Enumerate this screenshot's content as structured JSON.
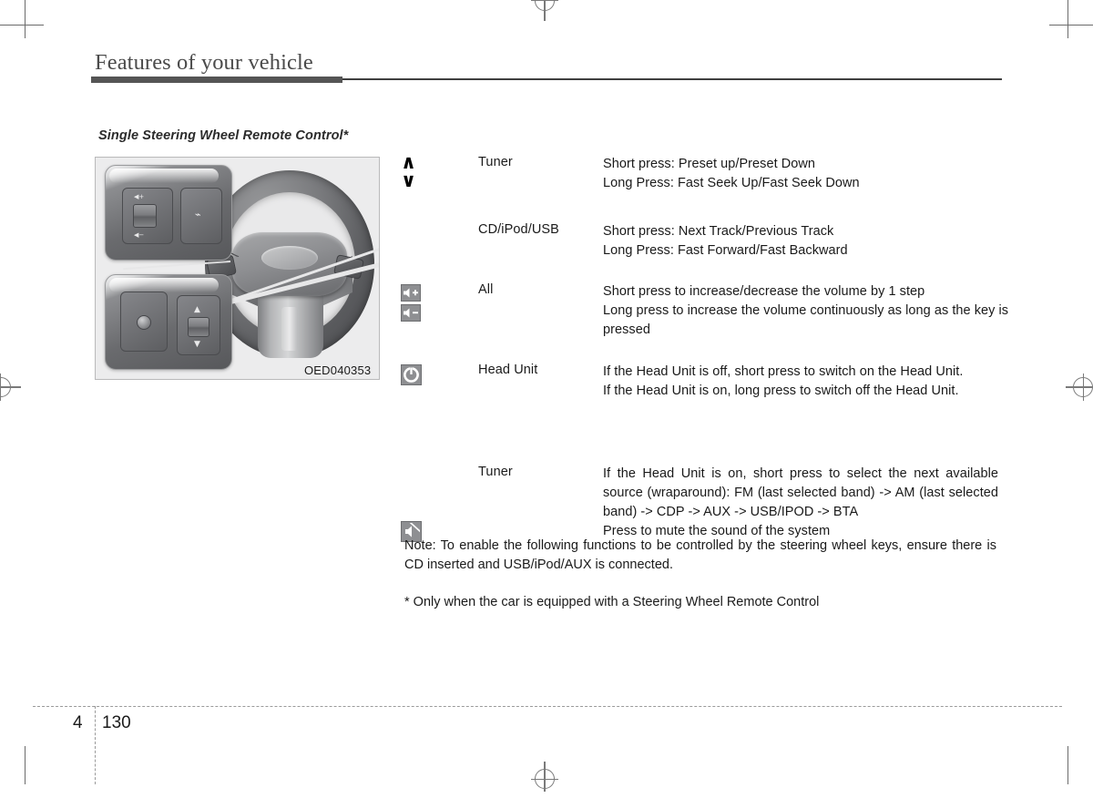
{
  "page": {
    "chapter_title": "Features of your vehicle",
    "section_title": "Single Steering Wheel Remote Control*",
    "chapter_number": "4",
    "page_number": "130"
  },
  "figure": {
    "caption": "OED040353",
    "alt_name": "steering-wheel-remote-control-illustration"
  },
  "table": {
    "rows": [
      {
        "icon": "seek-up-down-chevrons-icon",
        "mode": "Tuner",
        "lines": [
          "Short press: Preset up/Preset Down",
          "Long Press: Fast Seek Up/Fast Seek Down"
        ]
      },
      {
        "icon": "none",
        "mode": "CD/iPod/USB",
        "lines": [
          "Short press: Next Track/Previous Track",
          "Long Press: Fast Forward/Fast Backward"
        ]
      },
      {
        "icon": "volume-up-down-icon",
        "mode": "All",
        "lines": [
          "Short press to increase/decrease the volume by 1 step",
          "Long press to increase the volume continuously as long as the key is pressed"
        ]
      },
      {
        "icon": "power-mode-icon",
        "mode": "Head Unit",
        "lines": [
          "If the Head Unit is off, short press to switch on the Head Unit.",
          "If the Head Unit is on, long press to switch off the Head Unit."
        ]
      },
      {
        "icon": "mute-icon",
        "mode": "Tuner",
        "lines": [
          "If the Head Unit is on, short press to select the next available source (wraparound): FM (last selected band) -> AM (last selected band) -> CDP -> AUX -> USB/IPOD -> BTA",
          "Press to mute the sound of the system"
        ]
      }
    ]
  },
  "note": "Note: To enable the following functions to be controlled by the steering wheel keys, ensure there is CD inserted and USB/iPod/AUX is connected.",
  "footnote": "* Only when the car is equipped with a Steering Wheel Remote Control",
  "colors": {
    "rule_dark": "#555555",
    "figure_bg": "#ececed",
    "icon_box": "#8e8f92",
    "text": "#1a1a1a"
  }
}
